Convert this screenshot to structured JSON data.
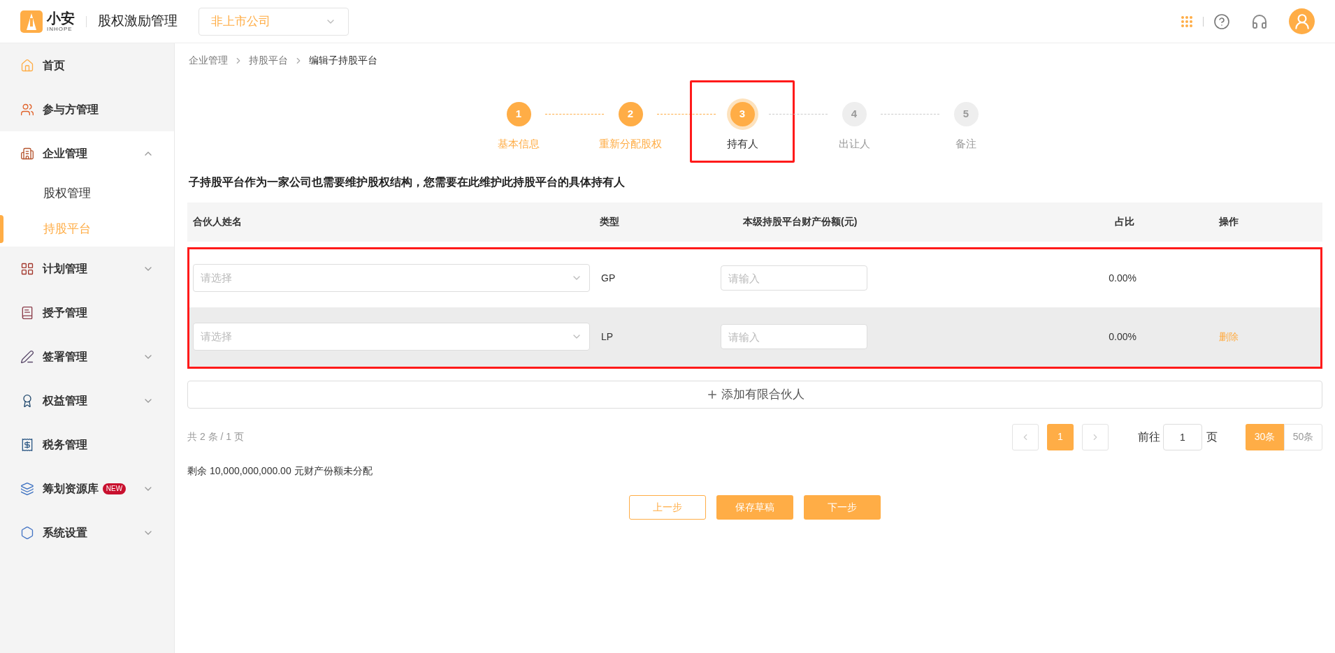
{
  "header": {
    "logo_text": "小安",
    "logo_subtext": "INHOPE",
    "app_title": "股权激励管理",
    "company_select": "非上市公司"
  },
  "sidebar": {
    "items": [
      {
        "label": "首页",
        "selected": false
      },
      {
        "label": "参与方管理",
        "selected": false
      },
      {
        "label": "企业管理",
        "selected": false,
        "expanded": true,
        "children": [
          {
            "label": "股权管理",
            "selected": false
          },
          {
            "label": "持股平台",
            "selected": true
          }
        ]
      },
      {
        "label": "计划管理",
        "selected": false,
        "expanded": false
      },
      {
        "label": "授予管理",
        "selected": false
      },
      {
        "label": "签署管理",
        "selected": false,
        "expanded": false
      },
      {
        "label": "权益管理",
        "selected": false,
        "expanded": false
      },
      {
        "label": "税务管理",
        "selected": false
      },
      {
        "label": "筹划资源库",
        "selected": false,
        "expanded": false,
        "badge": "NEW"
      },
      {
        "label": "系统设置",
        "selected": false,
        "expanded": false
      }
    ]
  },
  "breadcrumb": [
    "企业管理",
    "持股平台",
    "编辑子持股平台"
  ],
  "steps": [
    {
      "number": "1",
      "label": "基本信息",
      "completed": true,
      "current": false,
      "highlighted": false
    },
    {
      "number": "2",
      "label": "重新分配股权",
      "completed": true,
      "current": false,
      "highlighted": false
    },
    {
      "number": "3",
      "label": "持有人",
      "completed": false,
      "current": true,
      "highlighted": true
    },
    {
      "number": "4",
      "label": "出让人",
      "completed": false,
      "current": false,
      "highlighted": false
    },
    {
      "number": "5",
      "label": "备注",
      "completed": false,
      "current": false,
      "highlighted": false
    }
  ],
  "heading": "子持股平台作为一家公司也需要维护股权结构，您需要在此维护此持股平台的具体持有人",
  "table": {
    "columns": [
      "合伙人姓名",
      "类型",
      "本级持股平台财产份额(元)",
      "占比",
      "操作"
    ],
    "rows_highlighted": true,
    "rows": [
      {
        "name_placeholder": "请选择",
        "type": "GP",
        "amount_placeholder": "请输入",
        "ratio": "0.00%",
        "hovered": false
      },
      {
        "name_placeholder": "请选择",
        "type": "LP",
        "amount_placeholder": "请输入",
        "ratio": "0.00%",
        "action": "删除",
        "hovered": true
      }
    ]
  },
  "add_button": "添加有限合伙人",
  "pagination": {
    "summary": "共 2 条 / 1 页",
    "pages": [
      {
        "label": "1",
        "selected": true
      }
    ],
    "goto_label": "前往",
    "goto_value": "1",
    "goto_unit": "页",
    "sizes": [
      {
        "label": "30条",
        "selected": true
      },
      {
        "label": "50条",
        "selected": false
      }
    ]
  },
  "remaining": "剩余 10,000,000,000.00 元财产份额未分配",
  "buttons": [
    {
      "label": "上一步",
      "kind": "outline"
    },
    {
      "label": "保存草稿",
      "kind": "primary"
    },
    {
      "label": "下一步",
      "kind": "primary"
    }
  ]
}
